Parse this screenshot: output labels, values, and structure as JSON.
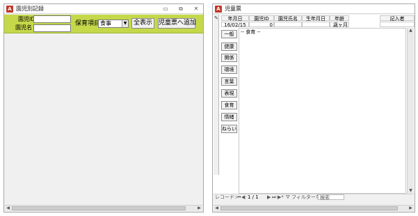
{
  "w1": {
    "title": "園児別記録",
    "label_id": "園児ID",
    "label_name": "園児名",
    "label_item": "保育項目",
    "item_value": "食事",
    "show_all": "全表示",
    "add_to": "児童票へ追加"
  },
  "w2": {
    "title": "児童票",
    "headers": [
      "年月日",
      "園児ID",
      "園児氏名",
      "生年月日",
      "年齢",
      "記入者"
    ],
    "row": {
      "date": "16/02/15",
      "id": "0",
      "name": "",
      "birth": "",
      "age": "歳ヶ月",
      "writer": ""
    },
    "side_buttons": [
      "一般",
      "健康",
      "関係",
      "環境",
      "言葉",
      "表現",
      "食育",
      "情緒",
      "ねらい"
    ],
    "memo": "-- 食育 --",
    "nav": {
      "label": "レコード:",
      "position": "1 / 1",
      "filter": "フィルターなし",
      "search": "検索"
    }
  }
}
